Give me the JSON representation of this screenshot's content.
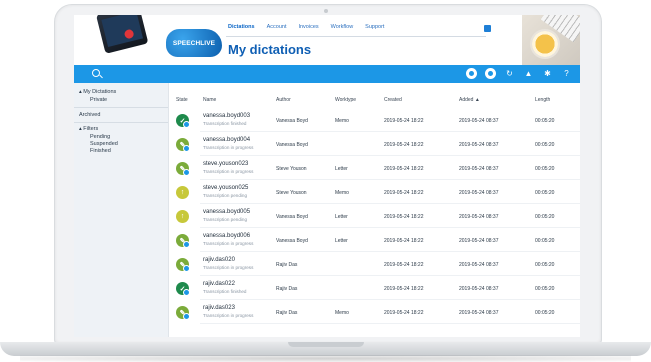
{
  "app": {
    "logo_text": "SPEECHLIVE"
  },
  "nav": {
    "items": [
      "Dictations",
      "Account",
      "Invoices",
      "Workflow",
      "Support"
    ],
    "active": "Dictations"
  },
  "page": {
    "title": "My dictations"
  },
  "toolbar": {
    "search_icon": "search-icon",
    "right_icons": [
      "record-icon",
      "record-alt-icon",
      "refresh-icon",
      "bell-icon",
      "gear-icon",
      "help-icon"
    ]
  },
  "sidebar": {
    "my_dictations": "My Dictations",
    "private": "Private",
    "archived": "Archived",
    "filters": "Filters",
    "pending": "Pending",
    "suspended": "Suspended",
    "finished": "Finished"
  },
  "table": {
    "headers": {
      "state": "State",
      "name": "Name",
      "author": "Author",
      "worktype": "Worktype",
      "created": "Created",
      "added": "Added ▲",
      "length": "Length"
    },
    "rows": [
      {
        "name": "vanessa.boyd003",
        "status": "Transcription finished",
        "author": "Vanessa Boyd",
        "worktype": "Memo",
        "created": "2019-05-24 18:22",
        "added": "2019-05-24 08:37",
        "length": "00:05:20",
        "state": "done"
      },
      {
        "name": "vanessa.boyd004",
        "status": "Transcription in progress",
        "author": "Vanessa Boyd",
        "worktype": "",
        "created": "2019-05-24 18:22",
        "added": "2019-05-24 08:37",
        "length": "00:05:20",
        "state": "prog"
      },
      {
        "name": "steve.youson023",
        "status": "Transcription in progress",
        "author": "Steve Youson",
        "worktype": "Letter",
        "created": "2019-05-24 18:22",
        "added": "2019-05-24 08:37",
        "length": "00:05:20",
        "state": "prog"
      },
      {
        "name": "steve.youson025",
        "status": "Transcription pending",
        "author": "Steve Youson",
        "worktype": "Memo",
        "created": "2019-05-24 18:22",
        "added": "2019-05-24 08:37",
        "length": "00:05:20",
        "state": "pend"
      },
      {
        "name": "vanessa.boyd005",
        "status": "Transcription pending",
        "author": "Vanessa Boyd",
        "worktype": "Letter",
        "created": "2019-05-24 18:22",
        "added": "2019-05-24 08:37",
        "length": "00:05:20",
        "state": "pend"
      },
      {
        "name": "vanessa.boyd006",
        "status": "Transcription in progress",
        "author": "Vanessa Boyd",
        "worktype": "Letter",
        "created": "2019-05-24 18:22",
        "added": "2019-05-24 08:37",
        "length": "00:05:20",
        "state": "prog"
      },
      {
        "name": "rajiv.das020",
        "status": "Transcription in progress",
        "author": "Rajiv Das",
        "worktype": "",
        "created": "2019-05-24 18:22",
        "added": "2019-05-24 08:37",
        "length": "00:05:20",
        "state": "prog"
      },
      {
        "name": "rajiv.das022",
        "status": "Transcription finished",
        "author": "Rajiv Das",
        "worktype": "",
        "created": "2019-05-24 18:22",
        "added": "2019-05-24 08:37",
        "length": "00:05:20",
        "state": "done"
      },
      {
        "name": "rajiv.das023",
        "status": "Transcription in progress",
        "author": "Rajiv Das",
        "worktype": "Memo",
        "created": "2019-05-24 18:22",
        "added": "2019-05-24 08:37",
        "length": "00:05:20",
        "state": "prog"
      }
    ]
  },
  "colors": {
    "accent": "#1c97e6",
    "title": "#0f5fb4",
    "done": "#1e8a4c",
    "progress": "#7bab3a",
    "pending": "#c7c83a"
  }
}
